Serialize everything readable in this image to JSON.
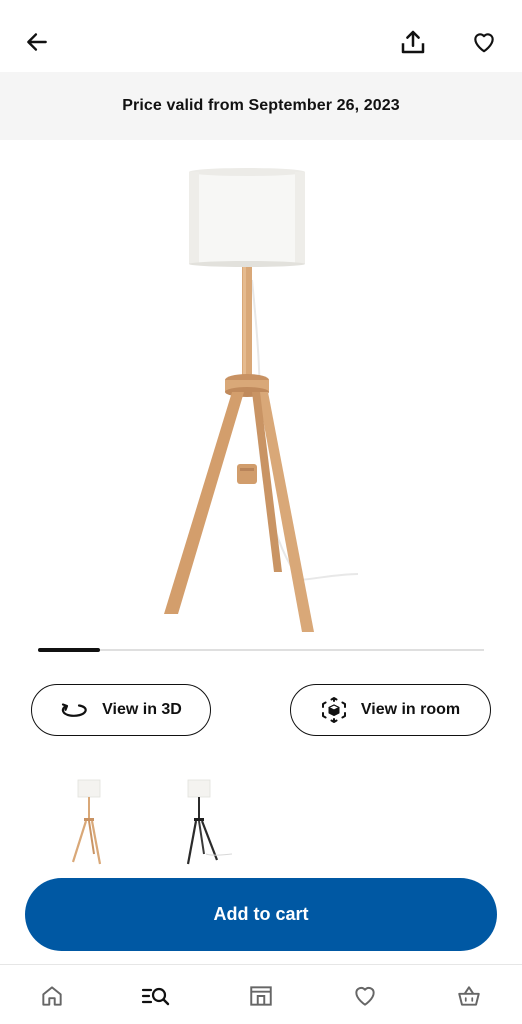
{
  "header": {
    "back_icon": "arrow-left-icon",
    "share_icon": "share-icon",
    "favourite_icon": "heart-icon"
  },
  "banner": {
    "text": "Price valid from September 26, 2023"
  },
  "gallery": {
    "progress": 0.14,
    "colors": {
      "wood": "#d9a878",
      "shade": "#f7f7f5",
      "dark": "#2b2b2b"
    }
  },
  "actions": {
    "view_3d_label": "View in 3D",
    "view_3d_icon": "rotate-3d-icon",
    "view_room_label": "View in room",
    "view_room_icon": "ar-cube-icon"
  },
  "variants": [
    {
      "icon": "floor-lamp-ash-thumbnail"
    },
    {
      "icon": "floor-lamp-black-thumbnail"
    }
  ],
  "cart": {
    "label": "Add to cart",
    "color": "#0058a3"
  },
  "bottom_nav": {
    "items": [
      {
        "icon": "home-icon"
      },
      {
        "icon": "search-list-icon",
        "active": true
      },
      {
        "icon": "store-icon"
      },
      {
        "icon": "heart-icon"
      },
      {
        "icon": "shopping-bag-icon"
      }
    ]
  }
}
